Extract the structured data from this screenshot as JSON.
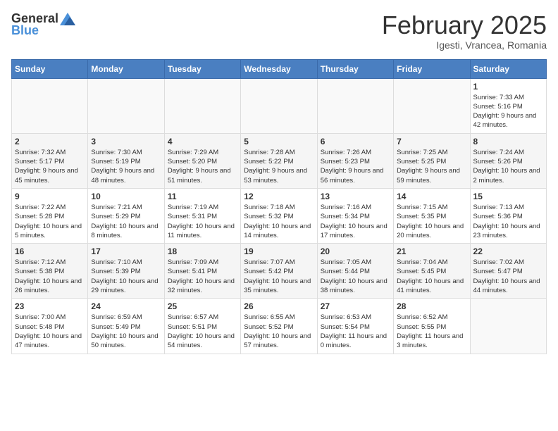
{
  "header": {
    "logo_general": "General",
    "logo_blue": "Blue",
    "month": "February 2025",
    "location": "Igesti, Vrancea, Romania"
  },
  "weekdays": [
    "Sunday",
    "Monday",
    "Tuesday",
    "Wednesday",
    "Thursday",
    "Friday",
    "Saturday"
  ],
  "weeks": [
    [
      {
        "day": "",
        "info": ""
      },
      {
        "day": "",
        "info": ""
      },
      {
        "day": "",
        "info": ""
      },
      {
        "day": "",
        "info": ""
      },
      {
        "day": "",
        "info": ""
      },
      {
        "day": "",
        "info": ""
      },
      {
        "day": "1",
        "info": "Sunrise: 7:33 AM\nSunset: 5:16 PM\nDaylight: 9 hours and 42 minutes."
      }
    ],
    [
      {
        "day": "2",
        "info": "Sunrise: 7:32 AM\nSunset: 5:17 PM\nDaylight: 9 hours and 45 minutes."
      },
      {
        "day": "3",
        "info": "Sunrise: 7:30 AM\nSunset: 5:19 PM\nDaylight: 9 hours and 48 minutes."
      },
      {
        "day": "4",
        "info": "Sunrise: 7:29 AM\nSunset: 5:20 PM\nDaylight: 9 hours and 51 minutes."
      },
      {
        "day": "5",
        "info": "Sunrise: 7:28 AM\nSunset: 5:22 PM\nDaylight: 9 hours and 53 minutes."
      },
      {
        "day": "6",
        "info": "Sunrise: 7:26 AM\nSunset: 5:23 PM\nDaylight: 9 hours and 56 minutes."
      },
      {
        "day": "7",
        "info": "Sunrise: 7:25 AM\nSunset: 5:25 PM\nDaylight: 9 hours and 59 minutes."
      },
      {
        "day": "8",
        "info": "Sunrise: 7:24 AM\nSunset: 5:26 PM\nDaylight: 10 hours and 2 minutes."
      }
    ],
    [
      {
        "day": "9",
        "info": "Sunrise: 7:22 AM\nSunset: 5:28 PM\nDaylight: 10 hours and 5 minutes."
      },
      {
        "day": "10",
        "info": "Sunrise: 7:21 AM\nSunset: 5:29 PM\nDaylight: 10 hours and 8 minutes."
      },
      {
        "day": "11",
        "info": "Sunrise: 7:19 AM\nSunset: 5:31 PM\nDaylight: 10 hours and 11 minutes."
      },
      {
        "day": "12",
        "info": "Sunrise: 7:18 AM\nSunset: 5:32 PM\nDaylight: 10 hours and 14 minutes."
      },
      {
        "day": "13",
        "info": "Sunrise: 7:16 AM\nSunset: 5:34 PM\nDaylight: 10 hours and 17 minutes."
      },
      {
        "day": "14",
        "info": "Sunrise: 7:15 AM\nSunset: 5:35 PM\nDaylight: 10 hours and 20 minutes."
      },
      {
        "day": "15",
        "info": "Sunrise: 7:13 AM\nSunset: 5:36 PM\nDaylight: 10 hours and 23 minutes."
      }
    ],
    [
      {
        "day": "16",
        "info": "Sunrise: 7:12 AM\nSunset: 5:38 PM\nDaylight: 10 hours and 26 minutes."
      },
      {
        "day": "17",
        "info": "Sunrise: 7:10 AM\nSunset: 5:39 PM\nDaylight: 10 hours and 29 minutes."
      },
      {
        "day": "18",
        "info": "Sunrise: 7:09 AM\nSunset: 5:41 PM\nDaylight: 10 hours and 32 minutes."
      },
      {
        "day": "19",
        "info": "Sunrise: 7:07 AM\nSunset: 5:42 PM\nDaylight: 10 hours and 35 minutes."
      },
      {
        "day": "20",
        "info": "Sunrise: 7:05 AM\nSunset: 5:44 PM\nDaylight: 10 hours and 38 minutes."
      },
      {
        "day": "21",
        "info": "Sunrise: 7:04 AM\nSunset: 5:45 PM\nDaylight: 10 hours and 41 minutes."
      },
      {
        "day": "22",
        "info": "Sunrise: 7:02 AM\nSunset: 5:47 PM\nDaylight: 10 hours and 44 minutes."
      }
    ],
    [
      {
        "day": "23",
        "info": "Sunrise: 7:00 AM\nSunset: 5:48 PM\nDaylight: 10 hours and 47 minutes."
      },
      {
        "day": "24",
        "info": "Sunrise: 6:59 AM\nSunset: 5:49 PM\nDaylight: 10 hours and 50 minutes."
      },
      {
        "day": "25",
        "info": "Sunrise: 6:57 AM\nSunset: 5:51 PM\nDaylight: 10 hours and 54 minutes."
      },
      {
        "day": "26",
        "info": "Sunrise: 6:55 AM\nSunset: 5:52 PM\nDaylight: 10 hours and 57 minutes."
      },
      {
        "day": "27",
        "info": "Sunrise: 6:53 AM\nSunset: 5:54 PM\nDaylight: 11 hours and 0 minutes."
      },
      {
        "day": "28",
        "info": "Sunrise: 6:52 AM\nSunset: 5:55 PM\nDaylight: 11 hours and 3 minutes."
      },
      {
        "day": "",
        "info": ""
      }
    ]
  ]
}
